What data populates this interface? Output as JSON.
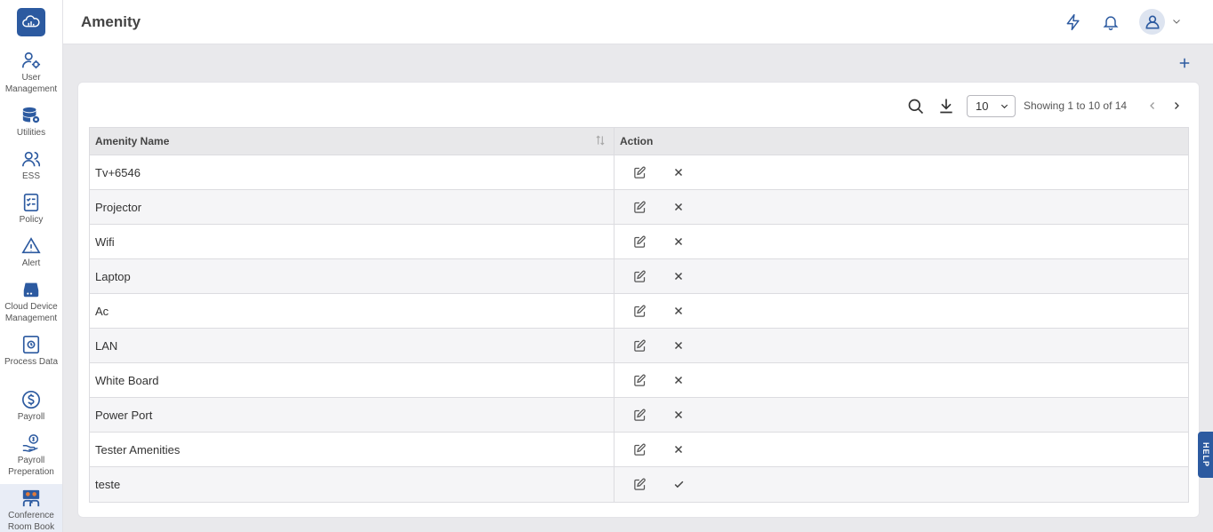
{
  "app": {
    "brand_color": "#2c5aa0"
  },
  "sidebar": {
    "items": [
      {
        "label": "User Management",
        "icon": "user-gear-icon"
      },
      {
        "label": "Utilities",
        "icon": "database-gear-icon"
      },
      {
        "label": "ESS",
        "icon": "users-icon"
      },
      {
        "label": "Policy",
        "icon": "checklist-icon"
      },
      {
        "label": "Alert",
        "icon": "warning-icon"
      },
      {
        "label": "Cloud Device Management",
        "icon": "device-icon"
      },
      {
        "label": "Process Data",
        "icon": "process-icon"
      },
      {
        "label": "Payroll",
        "icon": "dollar-icon"
      },
      {
        "label": "Payroll Preperation",
        "icon": "hand-dollar-icon"
      },
      {
        "label": "Conference Room Book",
        "icon": "conference-icon",
        "active": true
      }
    ]
  },
  "header": {
    "title": "Amenity",
    "icons": [
      "lightning-icon",
      "bell-icon",
      "user-avatar-icon",
      "chevron-down-icon"
    ]
  },
  "toolbar": {
    "page_size": "10",
    "showing_text": "Showing 1 to 10 of 14"
  },
  "table": {
    "columns": [
      "Amenity Name",
      "Action"
    ],
    "rows": [
      {
        "name": "Tv+6546",
        "status_icon": "close-icon"
      },
      {
        "name": "Projector",
        "status_icon": "close-icon"
      },
      {
        "name": "Wifi",
        "status_icon": "close-icon"
      },
      {
        "name": "Laptop",
        "status_icon": "close-icon"
      },
      {
        "name": "Ac",
        "status_icon": "close-icon"
      },
      {
        "name": "LAN",
        "status_icon": "close-icon"
      },
      {
        "name": "White Board",
        "status_icon": "close-icon"
      },
      {
        "name": "Power Port",
        "status_icon": "close-icon"
      },
      {
        "name": "Tester Amenities",
        "status_icon": "close-icon"
      },
      {
        "name": "teste",
        "status_icon": "check-icon"
      }
    ]
  },
  "help": {
    "label": "HELP"
  }
}
